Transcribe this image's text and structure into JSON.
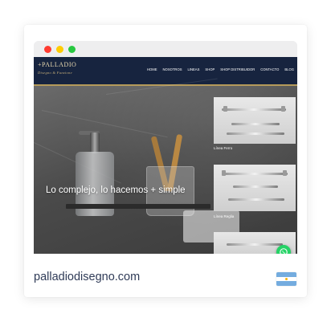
{
  "browser": {
    "window_buttons": [
      "close",
      "minimize",
      "maximize"
    ]
  },
  "site": {
    "logo": {
      "name": "+PALLADIO",
      "tagline": "Disegno & Funzione"
    },
    "menu": [
      "HOME",
      "NOSOTROS",
      "LINEAS",
      "SHOP",
      "SHOP DISTRIBUIDOR",
      "CONTACTO",
      "BLOG"
    ],
    "hero_text": "Lo complejo, lo hacemos + simple",
    "products": [
      {
        "label": "Línea Ferro"
      },
      {
        "label": "Línea Reglia"
      },
      {
        "label": ""
      }
    ],
    "whatsapp_icon": "whatsapp-icon"
  },
  "card": {
    "domain": "palladiodisegno.com",
    "flag_icon": "argentina-flag-icon"
  },
  "colors": {
    "nav_background": "#17243f",
    "nav_accent": "#b59a5a",
    "whatsapp_green": "#25d366",
    "domain_text": "#2f3b57"
  }
}
